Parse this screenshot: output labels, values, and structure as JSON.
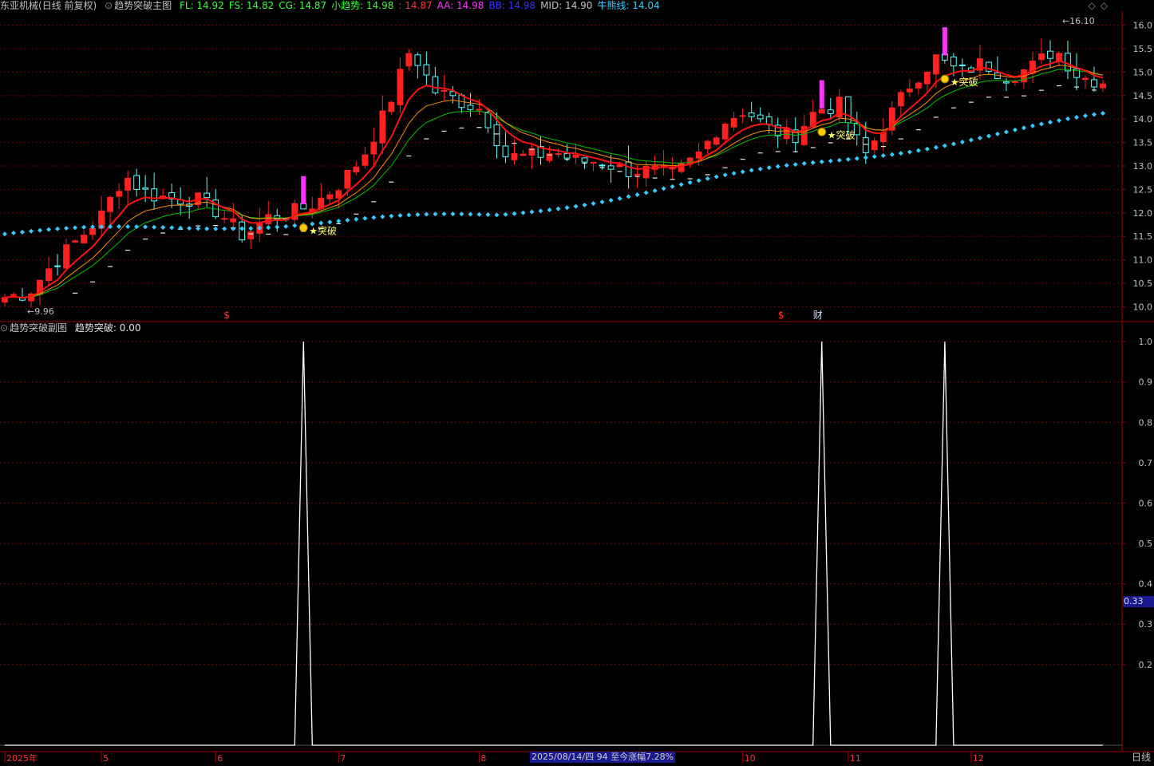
{
  "header": {
    "stock": "东亚机械",
    "period": "(日线 前复权)",
    "indicator": "趋势突破主图",
    "values": [
      {
        "label": "FL: 14.92",
        "color": "#33ff33"
      },
      {
        "label": "FS: 14.82",
        "color": "#33ff33"
      },
      {
        "label": "CG: 14.87",
        "color": "#33ff33"
      },
      {
        "label": "小趋势: 14.98",
        "color": "#33ff33"
      },
      {
        "label": ": 14.87",
        "color": "#ff3333"
      },
      {
        "label": "AA: 14.98",
        "color": "#ff33ff"
      },
      {
        "label": "BB: 14.98",
        "color": "#3333ff"
      },
      {
        "label": "MID: 14.90",
        "color": "#c0c0c0"
      },
      {
        "label": "牛熊线: 14.04",
        "color": "#33ccff"
      }
    ]
  },
  "sub_header": {
    "indicator": "趋势突破副图",
    "value": "趋势突破: 0.00"
  },
  "price_annotations": {
    "high": "16.10",
    "low": "9.96",
    "signal": "突破",
    "cai": "财",
    "dollar": "$"
  },
  "colors": {
    "up": "#ff2020",
    "down": "#54ffff",
    "ma_red": "#ff1010",
    "ma_green": "#00c000",
    "ma_orange": "#ff8c00",
    "bull_line": "#33ccff",
    "signal": "#ff33ff",
    "grid": "#7a0000",
    "axis": "#a00000"
  },
  "bottom_bar": {
    "status": "2025/08/14/四 94 至今涨幅7.28%",
    "right_label": "日线"
  },
  "sub_current_value": "0.33",
  "chart_data": [
    {
      "type": "candlestick",
      "title": "",
      "yticks": [
        "16.0",
        "15.5",
        "15.0",
        "14.5",
        "14.0",
        "13.5",
        "13.0",
        "12.5",
        "12.0",
        "11.5",
        "11.0",
        "10.5",
        "10.0"
      ],
      "ylim": [
        9.7,
        16.3
      ],
      "x_labels": [
        {
          "label": "2025年",
          "index": 0
        },
        {
          "label": "5",
          "index": 11
        },
        {
          "label": "6",
          "index": 24
        },
        {
          "label": "7",
          "index": 38
        },
        {
          "label": "8",
          "index": 54
        },
        {
          "label": "10",
          "index": 84
        },
        {
          "label": "11",
          "index": 96
        },
        {
          "label": "12",
          "index": 110
        }
      ],
      "series": [
        {
          "name": "FL",
          "values": []
        },
        {
          "name": "牛熊线",
          "values": []
        }
      ],
      "anchors": [
        10.2,
        10.3,
        10.9,
        11.4,
        11.9,
        12.8,
        12.4,
        12.3,
        12.3,
        12.0,
        11.5,
        11.9,
        12.0,
        12.2,
        12.6,
        13.2,
        14.2,
        15.5,
        14.6,
        14.4,
        14.2,
        13.2,
        13.2,
        13.3,
        13.1,
        13.1,
        12.9,
        12.9,
        12.8,
        13.2,
        13.9,
        14.2,
        13.8,
        13.6,
        14.2,
        14.3,
        13.2,
        14.0,
        14.8,
        15.3,
        15.0,
        15.2,
        14.9,
        15.1,
        15.5,
        14.9,
        14.8
      ],
      "candles_count": 126,
      "signals": [
        34,
        93,
        107
      ],
      "bull_line": {
        "start": 11.55,
        "mid": 11.95,
        "end": 14.05
      }
    },
    {
      "type": "line",
      "title": "",
      "yticks": [
        "1.0",
        "0.9",
        "0.8",
        "0.7",
        "0.6",
        "0.5",
        "0.4",
        "0.3",
        "0.2"
      ],
      "ylim": [
        0,
        1.02
      ],
      "signals": [
        34,
        93,
        107
      ],
      "points": 126
    }
  ]
}
